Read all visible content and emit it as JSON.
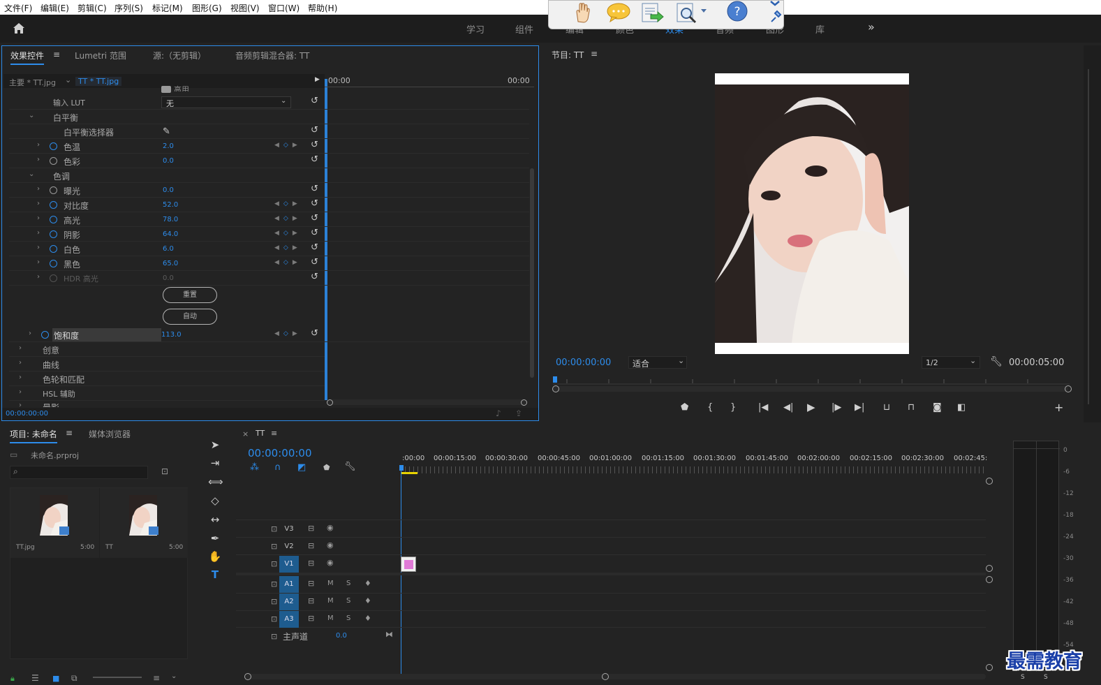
{
  "menu": [
    "文件(F)",
    "编辑(E)",
    "剪辑(C)",
    "序列(S)",
    "标记(M)",
    "图形(G)",
    "视图(V)",
    "窗口(W)",
    "帮助(H)"
  ],
  "workspaces": [
    "学习",
    "组件",
    "编辑",
    "颜色",
    "效果",
    "音频",
    "图形",
    "库"
  ],
  "effects_panel": {
    "tabs": [
      "效果控件",
      "Lumetri 范围",
      "源:（无剪辑）",
      "音频剪辑混合器: TT"
    ],
    "clip_master": "主要 * TT.jpg",
    "clip_sequence": "TT * TT.jpg",
    "time_start": "00:00",
    "time_end": "00:00",
    "partial_top": "高用",
    "input_lut_label": "输入 LUT",
    "input_lut_value": "无",
    "wb_section": "白平衡",
    "wb_selector": "白平衡选择器",
    "tone_section": "色调",
    "params": [
      {
        "name": "色温",
        "value": "2.0"
      },
      {
        "name": "色彩",
        "value": "0.0"
      },
      {
        "name": "曝光",
        "value": "0.0"
      },
      {
        "name": "对比度",
        "value": "52.0"
      },
      {
        "name": "高光",
        "value": "78.0"
      },
      {
        "name": "阴影",
        "value": "64.0"
      },
      {
        "name": "白色",
        "value": "6.0"
      },
      {
        "name": "黑色",
        "value": "65.0"
      },
      {
        "name": "HDR 高光",
        "value": "0.0"
      }
    ],
    "reset_button": "重置",
    "auto_button": "自动",
    "saturation_label": "饱和度",
    "saturation_value": "113.0",
    "sections": [
      "创意",
      "曲线",
      "色轮和匹配",
      "HSL 辅助",
      "晕影"
    ],
    "timecode": "00:00:00:00"
  },
  "program_monitor": {
    "title": "节目: TT",
    "timecode": "00:00:00:00",
    "fit": "适合",
    "resolution": "1/2",
    "duration": "00:00:05:00"
  },
  "project_panel": {
    "tabs": [
      "项目: 未命名",
      "媒体浏览器"
    ],
    "filename": "未命名.prproj",
    "items": [
      {
        "name": "TT.jpg",
        "duration": "5:00"
      },
      {
        "name": "TT",
        "duration": "5:00"
      }
    ]
  },
  "timeline": {
    "seq_name": "TT",
    "timecode": "00:00:00:00",
    "ruler": [
      ":00:00",
      "00:00:15:00",
      "00:00:30:00",
      "00:00:45:00",
      "00:01:00:00",
      "00:01:15:00",
      "00:01:30:00",
      "00:01:45:00",
      "00:02:00:00",
      "00:02:15:00",
      "00:02:30:00",
      "00:02:45:"
    ],
    "video_tracks": [
      "V3",
      "V2",
      "V1"
    ],
    "audio_tracks": [
      "A1",
      "A2",
      "A3"
    ],
    "master_label": "主声道",
    "master_value": "0.0",
    "m": "M",
    "s": "S"
  },
  "meter_scale": [
    "0",
    "-6",
    "-12",
    "-18",
    "-24",
    "-30",
    "-36",
    "-42",
    "-48",
    "-54"
  ],
  "watermark": "最需教育",
  "colors": {
    "accent": "#2d8ceb",
    "track_blue": "#1e5c8f",
    "clip_pink": "#e07ad6"
  }
}
